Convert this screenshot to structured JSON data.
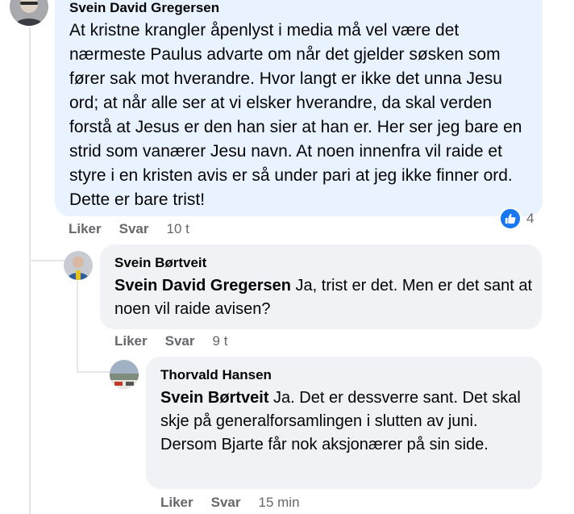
{
  "comments": [
    {
      "author": "Svein David Gregersen",
      "text": "At kristne krangler åpenlyst i media må vel være det nærmeste Paulus advarte om når det gjelder søsken som fører sak mot hverandre. Hvor langt er ikke det unna Jesu ord; at når alle ser at vi elsker hverandre, da skal verden forstå at Jesus er den han sier at han er. Her ser jeg bare en strid som vanærer Jesu navn. At noen innenfra vil raide et styre i en kristen avis er så under pari at jeg ikke finner ord. Dette er bare trist!",
      "like_label": "Liker",
      "reply_label": "Svar",
      "time": "10 t",
      "reaction_count": "4",
      "reaction_icon": "like-icon"
    },
    {
      "author": "Svein Børtveit",
      "mention": "Svein David Gregersen",
      "text": "Ja, trist er det. Men er det sant at noen vil raide avisen?",
      "like_label": "Liker",
      "reply_label": "Svar",
      "time": "9 t"
    },
    {
      "author": "Thorvald Hansen",
      "mention": "Svein Børtveit",
      "text": "Ja. Det er dessverre sant. Det skal skje på generalforsamlingen i slutten av juni. Dersom Bjarte får nok aksjonærer på sin side.",
      "like_label": "Liker",
      "reply_label": "Svar",
      "time": "15 min"
    }
  ],
  "colors": {
    "highlight_bubble": "#e8f3ff",
    "bubble": "#f0f2f5",
    "like_blue": "#1877f2",
    "secondary_text": "#65676b"
  }
}
